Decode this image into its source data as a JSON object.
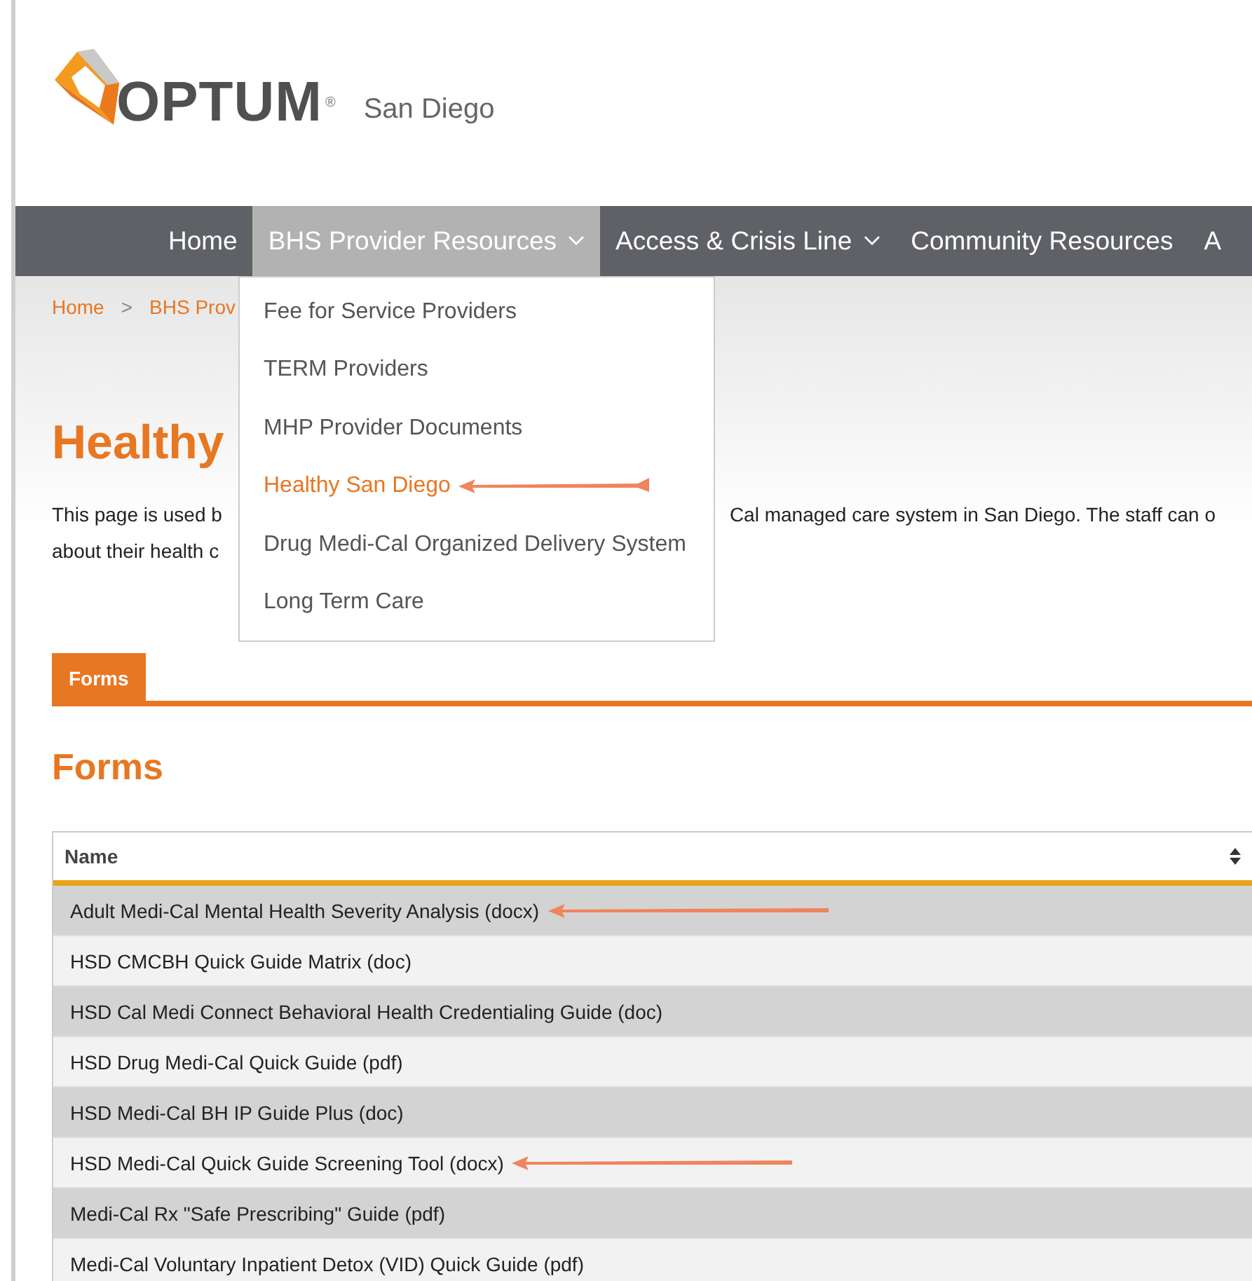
{
  "logo": {
    "wordmark": "OPTUM",
    "registered": "®",
    "region": "San Diego"
  },
  "nav": [
    {
      "label": "Home",
      "selected": false,
      "has_menu": false
    },
    {
      "label": "BHS Provider Resources",
      "selected": true,
      "has_menu": true
    },
    {
      "label": "Access & Crisis Line",
      "selected": false,
      "has_menu": true
    },
    {
      "label": "Community Resources",
      "selected": false,
      "has_menu": false
    },
    {
      "label": "A",
      "selected": false,
      "has_menu": false
    }
  ],
  "dropdown": {
    "items": [
      {
        "label": "Fee for Service Providers",
        "selected": false,
        "annotated": false
      },
      {
        "label": "TERM Providers",
        "selected": false,
        "annotated": false
      },
      {
        "label": "MHP Provider Documents",
        "selected": false,
        "annotated": false
      },
      {
        "label": "Healthy San Diego",
        "selected": true,
        "annotated": true
      },
      {
        "label": "Drug Medi-Cal Organized Delivery System",
        "selected": false,
        "annotated": false
      },
      {
        "label": "Long Term Care",
        "selected": false,
        "annotated": false
      }
    ]
  },
  "breadcrumb": [
    "Home",
    "BHS Prov"
  ],
  "breadcrumb_separator": ">",
  "page_title": "Healthy",
  "description": {
    "left_lines": [
      "This page is used b",
      "about their health c"
    ],
    "right_line": "Cal managed care system in San Diego. The staff can o"
  },
  "tabs": [
    {
      "label": "Forms",
      "selected": true
    }
  ],
  "section_title": "Forms",
  "table": {
    "columns": [
      {
        "label": "Name",
        "sortable": true
      }
    ],
    "rows": [
      {
        "name": "Adult Medi-Cal Mental Health Severity Analysis (docx)",
        "annotated": true
      },
      {
        "name": "HSD CMCBH Quick Guide Matrix (doc)",
        "annotated": false
      },
      {
        "name": "HSD Cal Medi Connect Behavioral Health Credentialing Guide (doc)",
        "annotated": false
      },
      {
        "name": "HSD Drug Medi-Cal Quick Guide (pdf)",
        "annotated": false
      },
      {
        "name": "HSD Medi-Cal BH IP Guide Plus (doc)",
        "annotated": false
      },
      {
        "name": "HSD Medi-Cal Quick Guide Screening Tool (docx)",
        "annotated": true
      },
      {
        "name": "Medi-Cal Rx \"Safe Prescribing\" Guide (pdf)",
        "annotated": false
      },
      {
        "name": "Medi-Cal Voluntary Inpatient Detox (VID) Quick Guide (pdf)",
        "annotated": false
      }
    ]
  }
}
